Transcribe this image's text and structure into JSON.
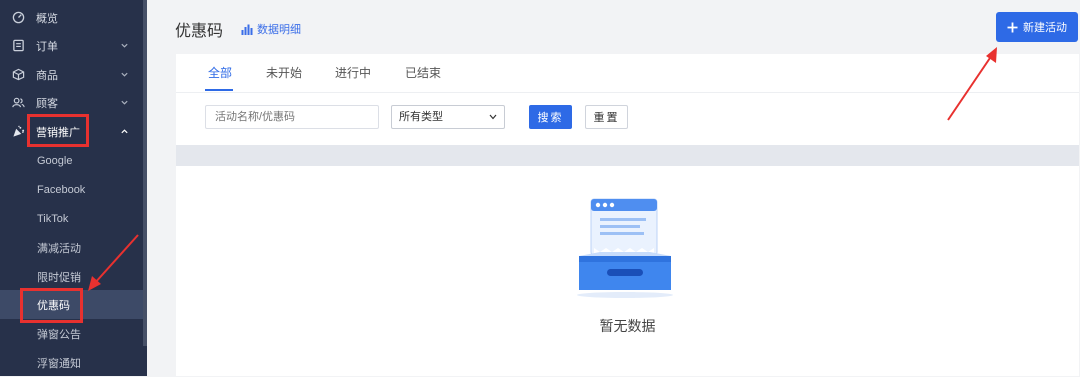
{
  "sidebar": {
    "items": [
      {
        "label": "概览",
        "icon": "dashboard-icon"
      },
      {
        "label": "订单",
        "icon": "order-icon"
      },
      {
        "label": "商品",
        "icon": "product-box-icon"
      },
      {
        "label": "顾客",
        "icon": "customers-icon"
      },
      {
        "label": "营销推广",
        "icon": "party-popper-icon"
      }
    ],
    "marketing_sub": [
      "Google",
      "Facebook",
      "TikTok",
      "满减活动",
      "限时促销",
      "优惠码",
      "弹窗公告",
      "浮窗通知"
    ],
    "active_sub": "优惠码"
  },
  "header": {
    "title": "优惠码",
    "data_link": "数据明细",
    "new_button": "新建活动"
  },
  "tabs": [
    "全部",
    "未开始",
    "进行中",
    "已结束"
  ],
  "filters": {
    "search_placeholder": "活动名称/优惠码",
    "type_select": "所有类型",
    "search_button": "搜索",
    "reset_button": "重置"
  },
  "empty_state": {
    "text": "暂无数据"
  },
  "colors": {
    "accent": "#2e6ae6",
    "sidebar_bg": "#27314a",
    "annotation_red": "#e8312f"
  }
}
